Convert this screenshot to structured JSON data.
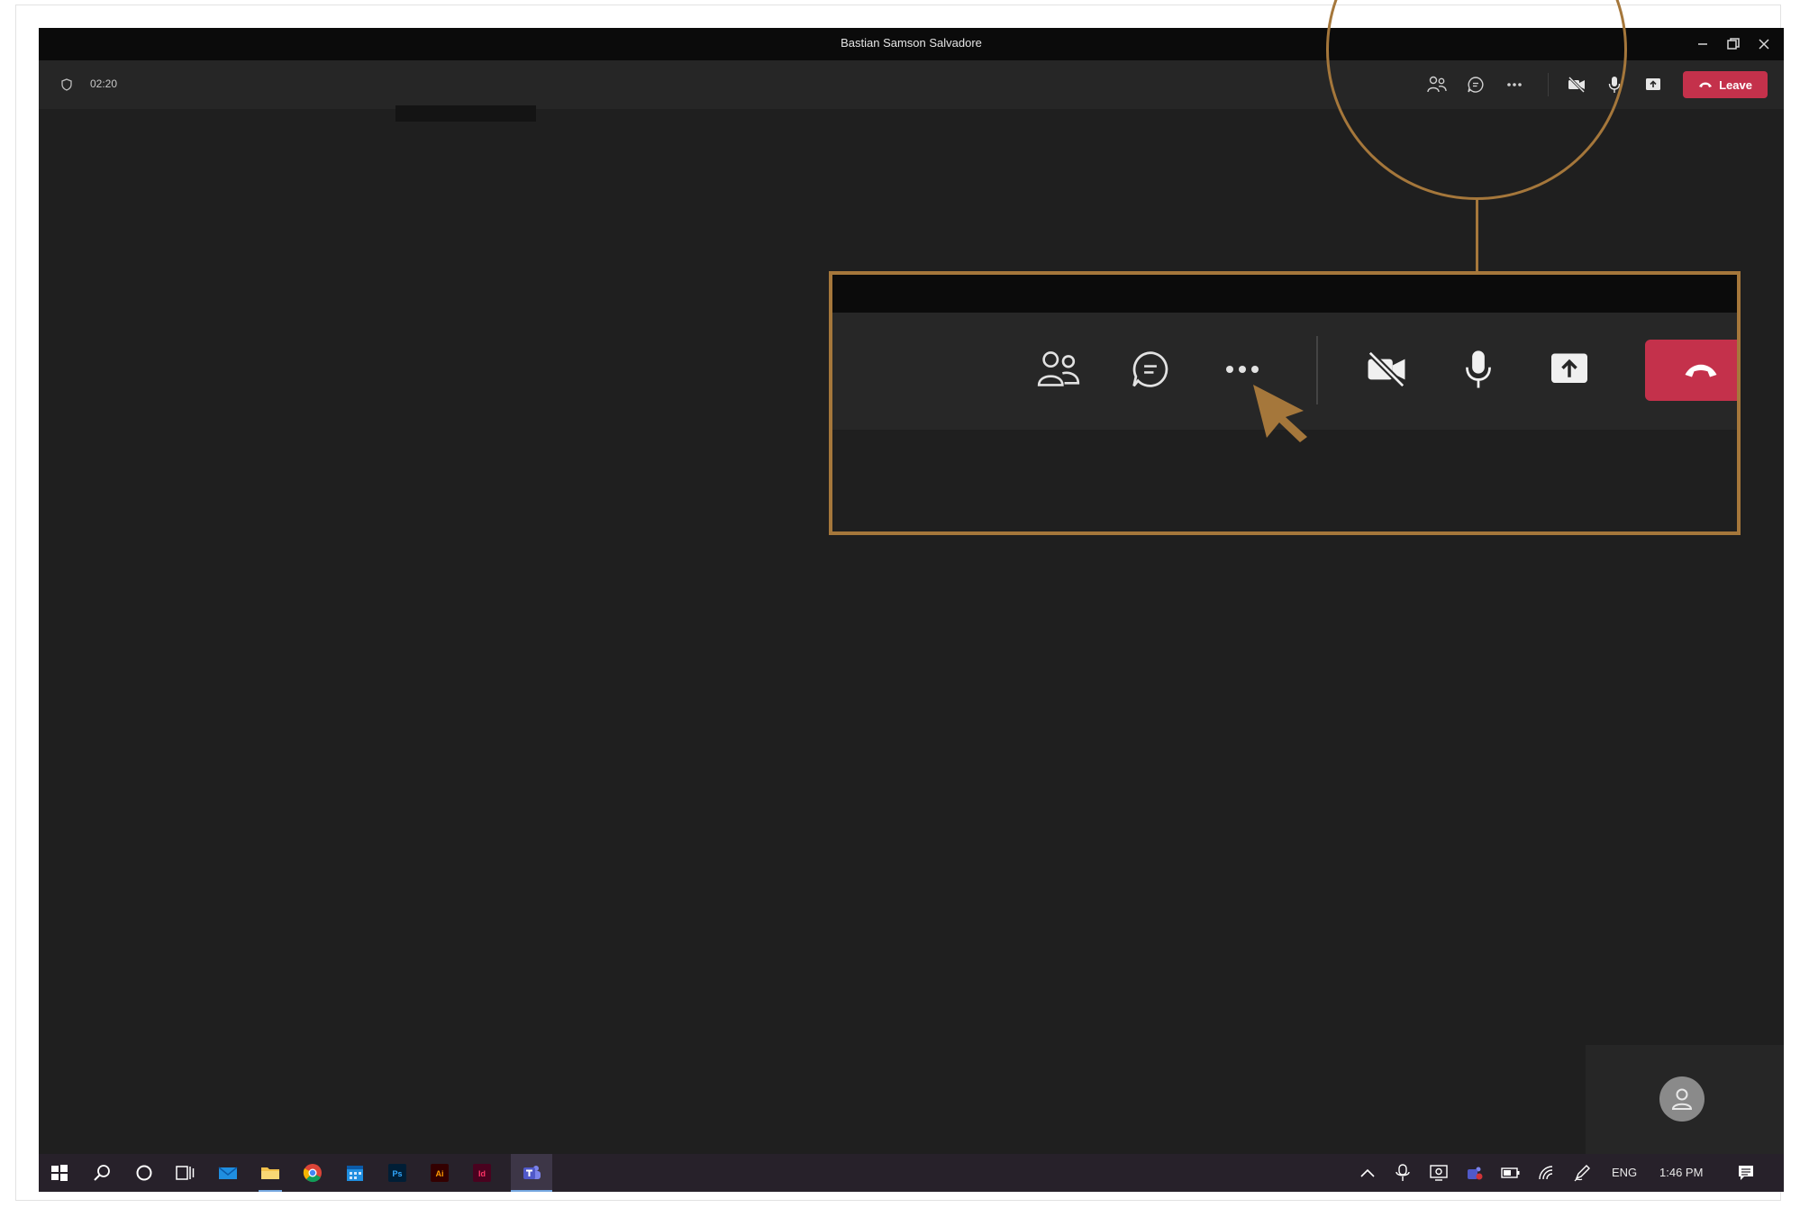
{
  "window": {
    "title": "Bastian Samson Salvadore",
    "controls": [
      "minimize-icon",
      "restore-icon",
      "close-icon"
    ]
  },
  "meeting_toolbar": {
    "timer": "02:20",
    "timer_icon": "shield-icon",
    "actions": [
      "people-icon",
      "chat-icon",
      "more-options-icon",
      "camera-off-icon",
      "microphone-icon",
      "share-screen-icon"
    ],
    "leave_label": "Leave",
    "leave_color": "#c4314b"
  },
  "callout": {
    "color": "#a5773b",
    "zoomed_actions": [
      "people-icon",
      "chat-icon",
      "more-options-icon",
      "camera-off-icon",
      "microphone-icon",
      "share-screen-icon",
      "hang-up-icon"
    ],
    "cursor": "pointer-cursor-icon"
  },
  "self_view": {
    "avatar": "user-avatar-icon"
  },
  "taskbar": {
    "apps": [
      "windows-start-icon",
      "search-icon",
      "cortana-icon",
      "task-view-icon",
      "mail-icon",
      "file-explorer-icon",
      "chrome-icon",
      "calendar-icon",
      "photoshop-icon",
      "illustrator-icon",
      "indesign-icon",
      "teams-icon"
    ],
    "app_labels": {
      "photoshop": "Ps",
      "illustrator": "Ai",
      "indesign": "Id"
    },
    "active_app": "teams-icon",
    "tray": [
      "show-hidden-icon",
      "meet-now-icon",
      "screen-capture-icon",
      "teams-tray-icon",
      "battery-icon",
      "wifi-icon",
      "pen-icon"
    ],
    "language": "ENG",
    "time": "1:46 PM",
    "notification_icon": "action-center-icon"
  }
}
